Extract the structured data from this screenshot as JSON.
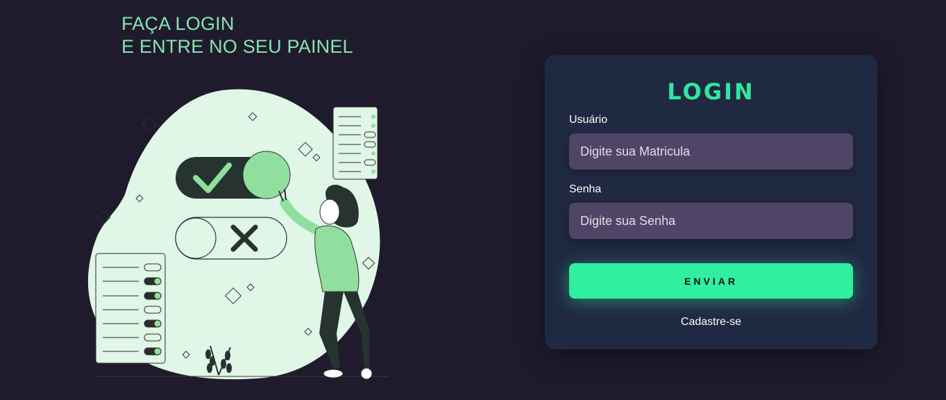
{
  "headline": {
    "line1": "FAÇA LOGIN",
    "line2": "E ENTRE NO SEU PAINEL"
  },
  "illustration": {
    "icon": "woman-toggling-checkmark-illustration",
    "accent_color": "#91df9f",
    "blob_color": "#e0f6e6"
  },
  "login_card": {
    "title": "LOGIN",
    "user_label": "Usuário",
    "user_placeholder": "Digite sua Matricula",
    "password_label": "Senha",
    "password_placeholder": "Digite sua Senha",
    "submit_label": "ENVIAR",
    "signup_link": "Cadastre-se"
  },
  "colors": {
    "background": "#1f1b2d",
    "card": "#202942",
    "accent": "#2ff0a0",
    "input": "#4f4566",
    "headline": "#86e5b2"
  }
}
